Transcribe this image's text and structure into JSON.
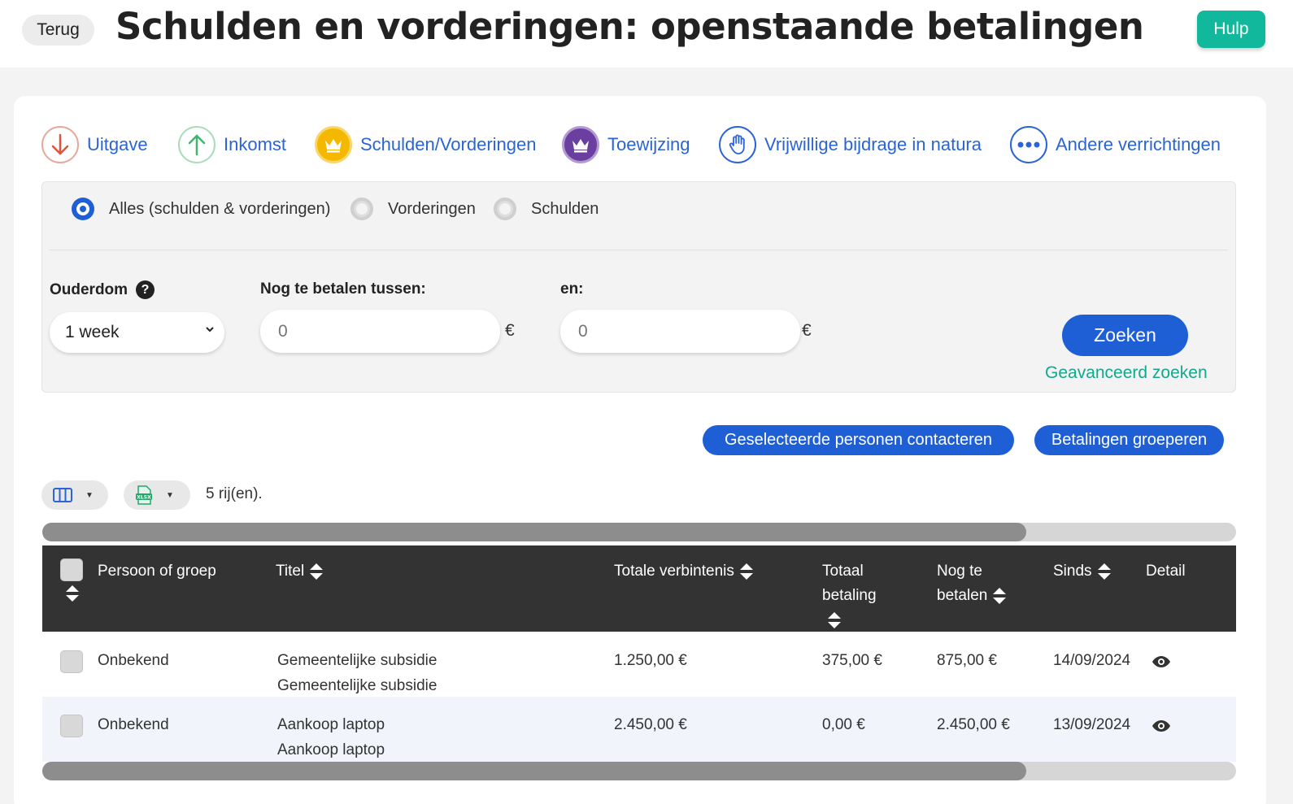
{
  "header": {
    "back_label": "Terug",
    "title": "Schulden en vorderingen: openstaande betalingen",
    "help_label": "Hulp"
  },
  "type_tabs": [
    {
      "label": "Uitgave",
      "icon": "arrow-down-icon",
      "color": "#e0533d"
    },
    {
      "label": "Inkomst",
      "icon": "arrow-up-icon",
      "color": "#3fb56d"
    },
    {
      "label": "Schulden/Vorderingen",
      "icon": "crown-icon",
      "color": "#f5b800"
    },
    {
      "label": "Toewijzing",
      "icon": "crown-transfer-icon",
      "color": "#6b3fa0"
    },
    {
      "label": "Vrijwillige bijdrage in natura",
      "icon": "hand-icon",
      "color": "#2a64d6"
    },
    {
      "label": "Andere verrichtingen",
      "icon": "more-icon",
      "color": "#2a64d6"
    }
  ],
  "filter": {
    "scope_options": [
      {
        "label": "Alles (schulden & vorderingen)",
        "selected": true
      },
      {
        "label": "Vorderingen",
        "selected": false
      },
      {
        "label": "Schulden",
        "selected": false
      }
    ],
    "age_label": "Ouderdom",
    "age_help": "?",
    "age_value": "1 week",
    "amount_between_label": "Nog te betalen tussen:",
    "amount_min_placeholder": "0",
    "and_label": "en:",
    "amount_max_placeholder": "0",
    "currency": "€",
    "search_label": "Zoeken",
    "advanced_label": "Geavanceerd zoeken"
  },
  "actions": {
    "contact_label": "Geselecteerde personen contacteren",
    "group_label": "Betalingen groeperen"
  },
  "toolbar": {
    "row_count": "5 rij(en)."
  },
  "table": {
    "columns": {
      "person": "Persoon of groep",
      "title": "Titel",
      "total_commitment": "Totale verbintenis",
      "total_payment_1": "Totaal",
      "total_payment_2": "betaling",
      "remaining_1": "Nog te",
      "remaining_2": "betalen",
      "since": "Sinds",
      "detail": "Detail"
    },
    "rows": [
      {
        "person": "Onbekend",
        "title": "Gemeentelijke subsidie",
        "subtitle": "Gemeentelijke subsidie",
        "total_commitment": "1.250,00 €",
        "total_payment": "375,00 €",
        "remaining": "875,00 €",
        "since": "14/09/2024"
      },
      {
        "person": "Onbekend",
        "title": "Aankoop laptop",
        "subtitle": "Aankoop laptop",
        "total_commitment": "2.450,00 €",
        "total_payment": "0,00 €",
        "remaining": "2.450,00 €",
        "since": "13/09/2024"
      }
    ]
  },
  "colors": {
    "primary": "#1f5fd6",
    "accent": "#12b89c",
    "table_header": "#333333"
  }
}
